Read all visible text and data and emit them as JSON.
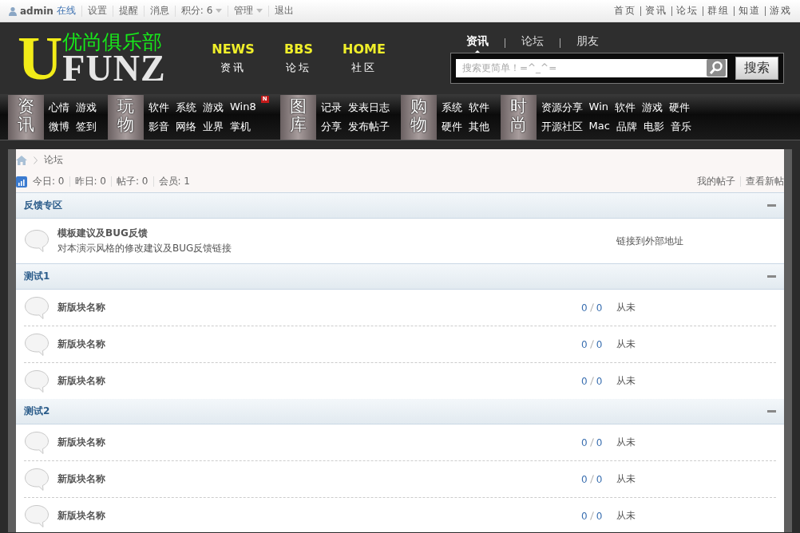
{
  "topbar": {
    "user": "admin",
    "status": "在线",
    "links": [
      {
        "label": "设置",
        "dropdown": false
      },
      {
        "label": "提醒",
        "dropdown": false
      },
      {
        "label": "消息",
        "dropdown": false
      },
      {
        "label": "积分: 6",
        "dropdown": true
      },
      {
        "label": "管理",
        "dropdown": true
      },
      {
        "label": "退出",
        "dropdown": false
      }
    ],
    "right_links": [
      "首页",
      "资讯",
      "论坛",
      "群组",
      "知道",
      "游戏"
    ]
  },
  "logo": {
    "letter": "U",
    "title": "优尚俱乐部",
    "word": "FUNZ"
  },
  "main_nav": [
    {
      "en": "NEWS",
      "zh": "资讯"
    },
    {
      "en": "BBS",
      "zh": "论坛"
    },
    {
      "en": "HOME",
      "zh": "社区"
    }
  ],
  "search": {
    "tabs": [
      {
        "label": "资讯",
        "selected": true
      },
      {
        "label": "论坛",
        "selected": false
      },
      {
        "label": "朋友",
        "selected": false
      }
    ],
    "placeholder": "搜索更简单！=^_^=",
    "button": "搜索"
  },
  "categories": [
    {
      "label": "资讯",
      "rows": [
        [
          {
            "text": "心情"
          },
          {
            "text": "游戏"
          }
        ],
        [
          {
            "text": "微博"
          },
          {
            "text": "签到"
          }
        ]
      ]
    },
    {
      "label": "玩物",
      "rows": [
        [
          {
            "text": "软件"
          },
          {
            "text": "系统"
          },
          {
            "text": "游戏"
          },
          {
            "text": "Win8",
            "badge": "N"
          }
        ],
        [
          {
            "text": "影音"
          },
          {
            "text": "网络"
          },
          {
            "text": "业界"
          },
          {
            "text": "掌机"
          }
        ]
      ]
    },
    {
      "label": "图库",
      "rows": [
        [
          {
            "text": "记录"
          },
          {
            "text": "发表日志"
          }
        ],
        [
          {
            "text": "分享"
          },
          {
            "text": "发布帖子"
          }
        ]
      ]
    },
    {
      "label": "购物",
      "rows": [
        [
          {
            "text": "系统"
          },
          {
            "text": "软件"
          }
        ],
        [
          {
            "text": "硬件"
          },
          {
            "text": "其他"
          }
        ]
      ]
    },
    {
      "label": "时尚",
      "rows": [
        [
          {
            "text": "资源分享"
          },
          {
            "text": "Win"
          },
          {
            "text": "软件"
          },
          {
            "text": "游戏"
          },
          {
            "text": "硬件"
          }
        ],
        [
          {
            "text": "开源社区"
          },
          {
            "text": "Mac"
          },
          {
            "text": "品牌"
          },
          {
            "text": "电影"
          },
          {
            "text": "音乐"
          }
        ]
      ]
    }
  ],
  "breadcrumb": [
    "论坛"
  ],
  "stats": [
    "今日: 0",
    "昨日: 0",
    "帖子: 0",
    "会员: 1"
  ],
  "stats_links": [
    "我的帖子",
    "查看新帖"
  ],
  "sections": [
    {
      "title": "反馈专区",
      "expanded": true,
      "forums": [
        {
          "kind": "link",
          "name": "模板建议及BUG反馈",
          "description": "对本演示风格的修改建议及BUG反馈链接",
          "note": "链接到外部地址"
        }
      ]
    },
    {
      "title": "测试1",
      "expanded": true,
      "forums": [
        {
          "kind": "forum",
          "name": "新版块名称",
          "threads": "0",
          "posts": "0",
          "last": "从未"
        },
        {
          "kind": "forum",
          "name": "新版块名称",
          "threads": "0",
          "posts": "0",
          "last": "从未"
        },
        {
          "kind": "forum",
          "name": "新版块名称",
          "threads": "0",
          "posts": "0",
          "last": "从未"
        }
      ]
    },
    {
      "title": "测试2",
      "expanded": true,
      "forums": [
        {
          "kind": "forum",
          "name": "新版块名称",
          "threads": "0",
          "posts": "0",
          "last": "从未"
        },
        {
          "kind": "forum",
          "name": "新版块名称",
          "threads": "0",
          "posts": "0",
          "last": "从未"
        },
        {
          "kind": "forum",
          "name": "新版块名称",
          "threads": "0",
          "posts": "0",
          "last": "从未"
        }
      ]
    }
  ]
}
